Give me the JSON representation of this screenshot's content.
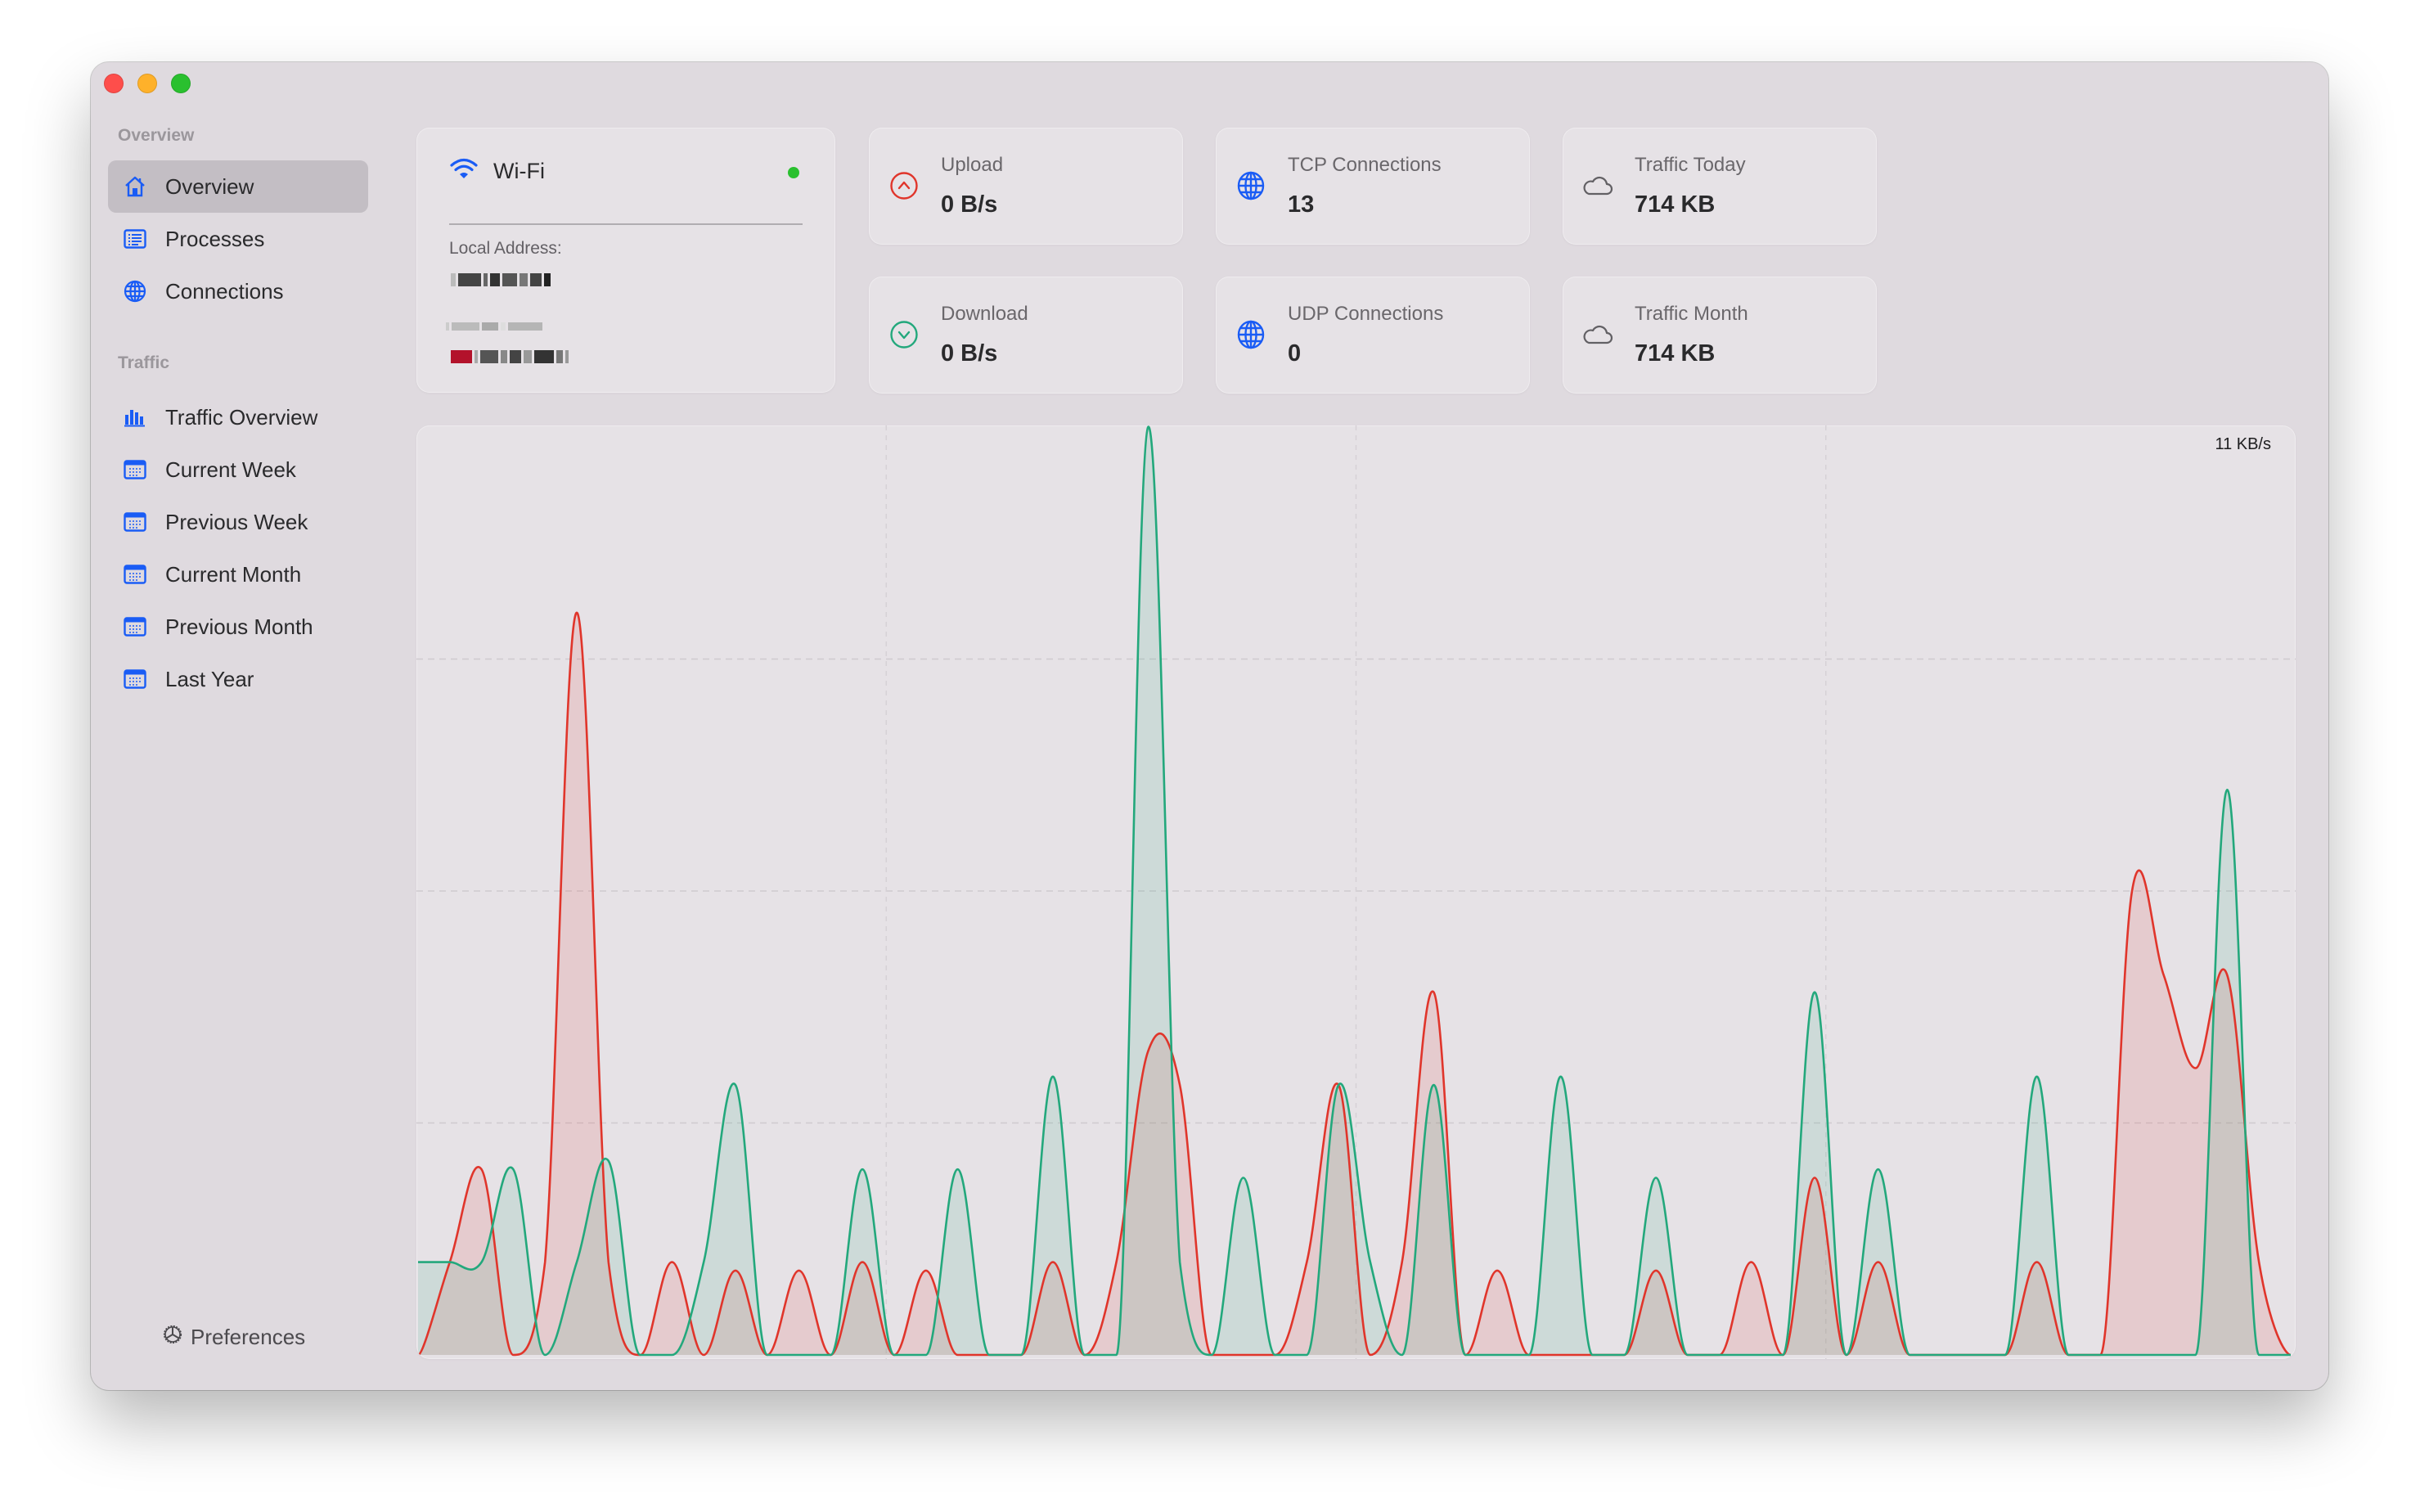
{
  "window": {
    "controls": [
      "close",
      "minimize",
      "maximize"
    ]
  },
  "sidebar": {
    "sections": [
      {
        "label": "Overview",
        "items": [
          {
            "label": "Overview",
            "icon": "house-icon",
            "active": true
          },
          {
            "label": "Processes",
            "icon": "list-icon",
            "active": false
          },
          {
            "label": "Connections",
            "icon": "globe-icon",
            "active": false
          }
        ]
      },
      {
        "label": "Traffic",
        "items": [
          {
            "label": "Traffic Overview",
            "icon": "bar-chart-icon",
            "active": false
          },
          {
            "label": "Current Week",
            "icon": "calendar-icon",
            "active": false
          },
          {
            "label": "Previous Week",
            "icon": "calendar-icon",
            "active": false
          },
          {
            "label": "Current Month",
            "icon": "calendar-icon",
            "active": false
          },
          {
            "label": "Previous Month",
            "icon": "calendar-icon",
            "active": false
          },
          {
            "label": "Last Year",
            "icon": "calendar-icon",
            "active": false
          }
        ]
      }
    ],
    "preferences_label": "Preferences"
  },
  "interface": {
    "name": "Wi-Fi",
    "status": "connected",
    "status_color": "#2ac02f",
    "local_address_label": "Local Address:",
    "local_address": "[redacted]",
    "secondary_label": "[redacted]",
    "secondary_address": "[redacted]"
  },
  "stats": {
    "upload": {
      "title": "Upload",
      "value": "0 B/s",
      "icon": "arrow-up-circle-icon",
      "color": "#e0352b"
    },
    "download": {
      "title": "Download",
      "value": "0 B/s",
      "icon": "arrow-down-circle-icon",
      "color": "#23a87c"
    },
    "tcp": {
      "title": "TCP Connections",
      "value": "13",
      "icon": "globe-icon"
    },
    "udp": {
      "title": "UDP Connections",
      "value": "0",
      "icon": "globe-icon"
    },
    "traffic_today": {
      "title": "Traffic Today",
      "value": "714 KB",
      "icon": "cloud-icon"
    },
    "traffic_month": {
      "title": "Traffic Month",
      "value": "714 KB",
      "icon": "cloud-icon"
    }
  },
  "colors": {
    "accent": "#1a5cf5",
    "upload": "#e0352b",
    "download": "#23a87c"
  },
  "chart_data": {
    "type": "area",
    "title": "",
    "xlabel": "",
    "ylabel": "",
    "max_label": "11 KB/s",
    "unit": "KB/s",
    "ylim": [
      0,
      11
    ],
    "grid": true,
    "x_gridlines": 3,
    "y_gridlines": 3,
    "legend": "none",
    "x": [
      0,
      1,
      2,
      3,
      4,
      5,
      6,
      7,
      8,
      9,
      10,
      11,
      12,
      13,
      14,
      15,
      16,
      17,
      18,
      19,
      20,
      21,
      22,
      23,
      24,
      25,
      26,
      27,
      28,
      29,
      30,
      31,
      32,
      33,
      34,
      35,
      36,
      37,
      38,
      39,
      40,
      41,
      42,
      43,
      44,
      45,
      46,
      47,
      48,
      49,
      50,
      51,
      52,
      53,
      54,
      55,
      56,
      57,
      58,
      59
    ],
    "series": [
      {
        "name": "Upload",
        "color": "#e0352b",
        "values": [
          0,
          1.1,
          2.2,
          0,
          1.1,
          8.8,
          1.1,
          0,
          1.1,
          0,
          1.0,
          0,
          1.0,
          0,
          1.1,
          0,
          1.0,
          0,
          0,
          0,
          1.1,
          0,
          1.1,
          3.6,
          3.2,
          0,
          0,
          0,
          1.1,
          3.2,
          0,
          1.1,
          4.3,
          0,
          1.0,
          0,
          0,
          0,
          0,
          1.0,
          0,
          0,
          1.1,
          0,
          2.1,
          0,
          1.1,
          0,
          0,
          0,
          0,
          1.1,
          0,
          0,
          5.5,
          4.5,
          3.4,
          4.5,
          1.1,
          0
        ]
      },
      {
        "name": "Download",
        "color": "#23a87c",
        "values": [
          1.1,
          1.1,
          1.1,
          2.2,
          0,
          1.1,
          2.3,
          0,
          0,
          1.1,
          3.2,
          0,
          0,
          0,
          2.2,
          0,
          0,
          2.2,
          0,
          0,
          3.3,
          0,
          0,
          11,
          1.1,
          0,
          2.1,
          0,
          0,
          3.2,
          1.1,
          0,
          3.2,
          0,
          0,
          0,
          3.3,
          0,
          0,
          2.1,
          0,
          0,
          0,
          0,
          4.3,
          0,
          2.2,
          0,
          0,
          0,
          0,
          3.3,
          0,
          0,
          0,
          0,
          0,
          6.7,
          0,
          0
        ]
      }
    ]
  }
}
